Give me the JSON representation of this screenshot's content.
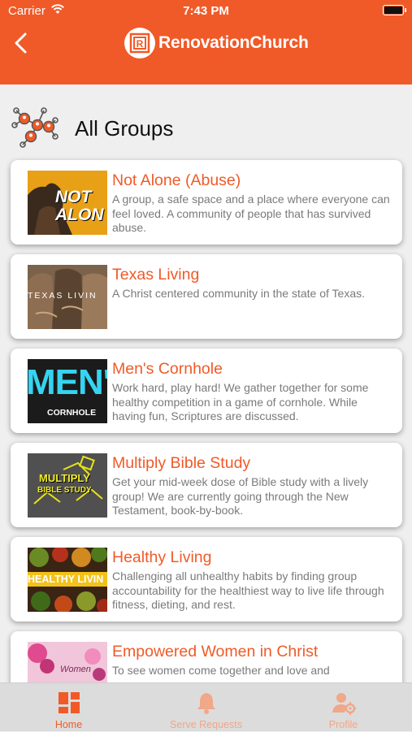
{
  "status_bar": {
    "carrier": "Carrier",
    "time": "7:43 PM"
  },
  "header": {
    "logo_text": "RenovationChurch",
    "logo_mark": "R",
    "accent": "#f05a28"
  },
  "page": {
    "title": "All Groups"
  },
  "groups": [
    {
      "title": "Not Alone (Abuse)",
      "description": "A group, a safe space and a place where everyone can feel loved. A community of people that has survived abuse.",
      "thumb_text": "NOT ALON",
      "thumb_icon": "silhouette-image"
    },
    {
      "title": "Texas Living",
      "description": "A Christ centered community in the state of Texas.",
      "thumb_text": "TEXAS LIVIN",
      "thumb_icon": "cowboy-boots-image"
    },
    {
      "title": "Men's Cornhole",
      "description": "Work hard, play hard! We gather together for some healthy competition in a game of cornhole. While having fun, Scriptures are discussed.",
      "thumb_text": "MEN'S",
      "thumb_subtext": "CORNHOLE",
      "thumb_icon": "cornhole-image"
    },
    {
      "title": "Multiply Bible Study",
      "description": "Get your mid-week dose of Bible study with a lively group! We are currently going through the New Testament, book-by-book.",
      "thumb_text": "MULTIPLY",
      "thumb_subtext": "BIBLE STUDY",
      "thumb_icon": "bible-study-image"
    },
    {
      "title": "Healthy Living",
      "description": "Challenging all unhealthy habits by finding group accountability for the healthiest way to live life through fitness, dieting, and rest.",
      "thumb_text": "HEALTHY LIVIN",
      "thumb_icon": "vegetables-image"
    },
    {
      "title": "Empowered Women in Christ",
      "description": "To see women come together and love and",
      "thumb_text": "Women",
      "thumb_icon": "flowers-image"
    }
  ],
  "tabbar": {
    "tabs": [
      {
        "label": "Home",
        "icon": "home-grid-icon",
        "active": true
      },
      {
        "label": "Serve Requests",
        "icon": "bell-icon",
        "active": false
      },
      {
        "label": "Profile",
        "icon": "profile-gear-icon",
        "active": false
      }
    ],
    "active_color": "#f05a28",
    "inactive_color": "#f0a78a"
  }
}
